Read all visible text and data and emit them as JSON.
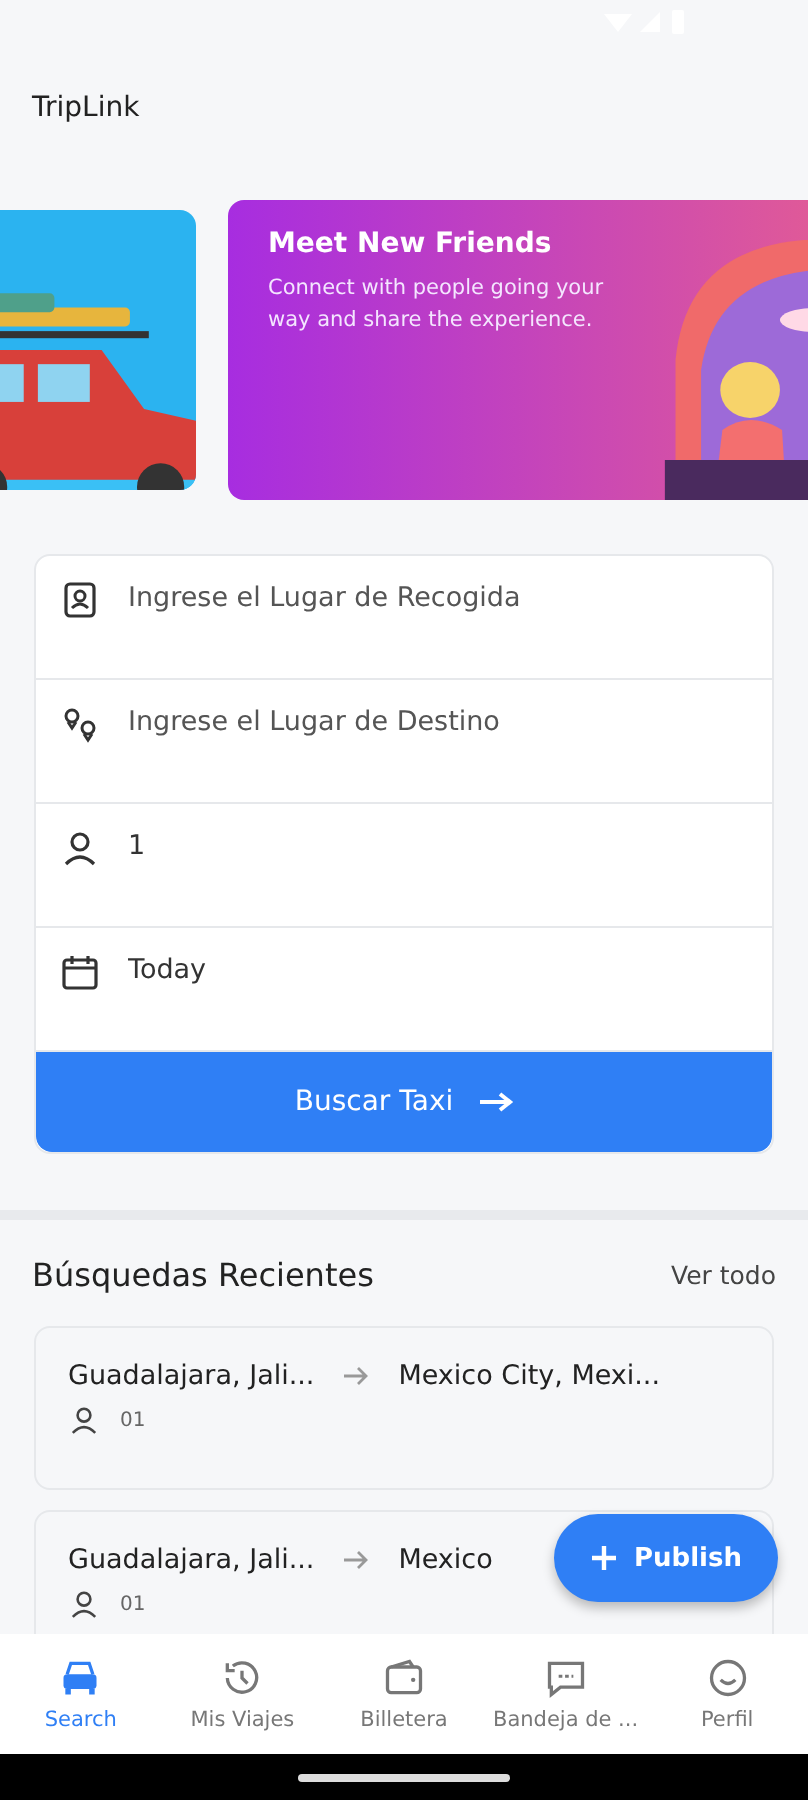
{
  "app_bar": {
    "title": "TripLink"
  },
  "banners": [
    {
      "kind": "picture"
    },
    {
      "title": "Meet New Friends",
      "text": "Connect with people going your way and share the experience."
    }
  ],
  "search_form": {
    "fields": [
      {
        "placeholder": "Ingrese el Lugar de Recogida"
      },
      {
        "placeholder": "Ingrese el Lugar de Destino"
      },
      {
        "value": "1"
      },
      {
        "value": "Today"
      }
    ],
    "button": "Buscar Taxi"
  },
  "recent": {
    "title": "Búsquedas Recientes",
    "link": "Ver todo",
    "items": [
      {
        "from": "Guadalajara, Jali...",
        "to": "Mexico City, Mexi...",
        "passengers": "01"
      },
      {
        "from": "Guadalajara, Jali...",
        "to": "Mexico",
        "passengers": "01"
      }
    ]
  },
  "fab": {
    "label": "Publish"
  },
  "bottom_nav": [
    {
      "label": "Search",
      "selected": true
    },
    {
      "label": "Mis Viajes",
      "selected": false
    },
    {
      "label": "Billetera",
      "selected": false
    },
    {
      "label": "Bandeja de ...",
      "selected": false
    },
    {
      "label": "Perfil",
      "selected": false
    }
  ]
}
